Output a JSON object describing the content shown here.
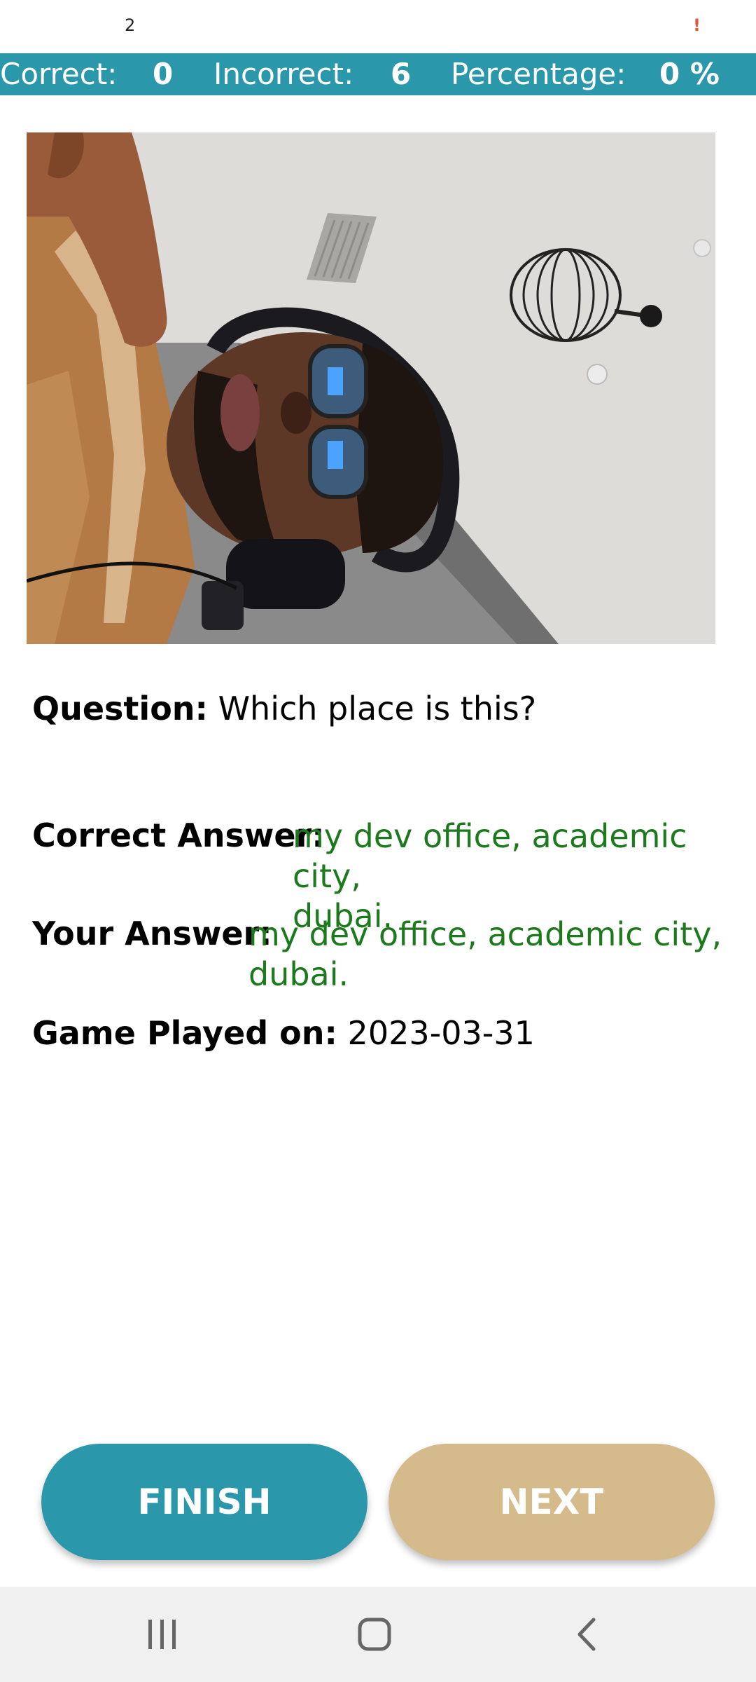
{
  "status_bar": {
    "left_text": "2",
    "right_text": "!"
  },
  "scoreboard": {
    "correct_label": "Correct:",
    "correct_value": "0",
    "incorrect_label": "Incorrect:",
    "incorrect_value": "6",
    "percentage_label": "Percentage:",
    "percentage_value": "0 %"
  },
  "photo": {
    "icon": "selfie-photo"
  },
  "question": {
    "label": "Question:",
    "text": "Which place is this?"
  },
  "correct_answer": {
    "label": "Correct Answer:",
    "line1": "my dev office, academic city,",
    "line2": "dubai."
  },
  "your_answer": {
    "label": "Your Answer:",
    "line1": "my dev office, academic city,",
    "line2": "dubai."
  },
  "game_played": {
    "label": "Game Played on:",
    "date": "2023-03-31"
  },
  "buttons": {
    "finish": "FINISH",
    "next": "NEXT"
  },
  "colors": {
    "accent": "#2a98aa",
    "next_button": "#d5bb8c",
    "answer_green": "#1c7a1c"
  },
  "nav": {
    "recents_icon": "recents-icon",
    "home_icon": "home-icon",
    "back_icon": "back-icon"
  }
}
